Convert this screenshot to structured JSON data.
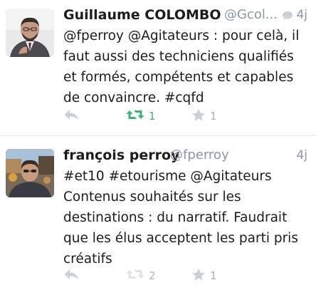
{
  "tweets": [
    {
      "name": "Guillaume COLOMBO",
      "handle": "@Gcol...",
      "time": "4j",
      "text": "@fperroy @Agitateurs : pour celà, il faut aussi des techniciens qualifiés et formés, compétents et capables de convaincre. #cqfd",
      "retweet_count": "1",
      "favorite_count": "1",
      "retweeted": true,
      "retweet_color": "#3cb371"
    },
    {
      "name": "françois perroy",
      "handle": "@fperroy",
      "time": "4j",
      "text": "#et10 #etourisme @Agitateurs Contenus souhaités sur les destinations : du narratif. Faudrait que les élus acceptent les parti pris créatifs",
      "retweet_count": "2",
      "favorite_count": "1",
      "retweeted": false,
      "retweet_color": "#c9d1d8"
    }
  ],
  "colors": {
    "icon_gray": "#c9d1d8",
    "handle_gray": "#8899a6",
    "retweet_green": "#3cb371"
  }
}
